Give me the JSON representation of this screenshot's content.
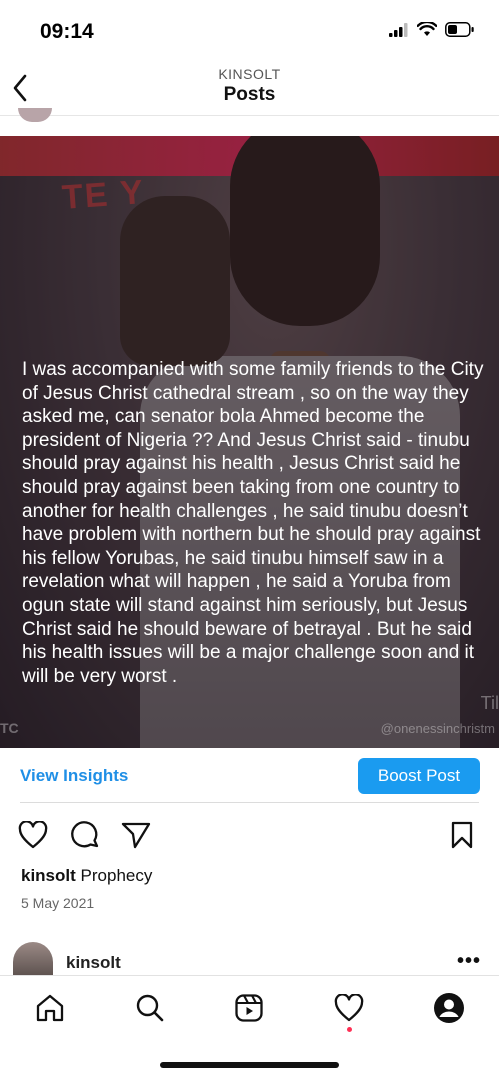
{
  "status_bar": {
    "time": "09:14"
  },
  "header": {
    "account": "KINSOLT",
    "title": "Posts"
  },
  "post": {
    "body_text": "I was accompanied with some family friends to the City of Jesus Christ cathedral stream ,  so on the way they asked me, can senator bola Ahmed become the president of Nigeria ?? And Jesus Christ said - tinubu should pray against his health ,  Jesus Christ said he should pray against been taking from one country to another for health challenges , he said tinubu doesn’t have problem with northern but he should pray against his fellow Yorubas, he said tinubu himself saw in a revelation what will happen ,  he said a Yoruba from ogun state will stand against him seriously,  but Jesus Christ said he should beware of betrayal .  But he said his health issues will be a major challenge soon and it will be very worst .",
    "banner_text": "TE Y",
    "watermark": "@onenessinchristm",
    "watermark_left": "TC",
    "watermark_right": "Til"
  },
  "insights": {
    "view_label": "View Insights",
    "boost_label": "Boost Post"
  },
  "caption": {
    "username": "kinsolt",
    "text": "Prophecy",
    "date": "5 May 2021"
  },
  "next_post": {
    "username": "kinsolt",
    "more": "•••"
  },
  "icons": {
    "back": "chevron-left-icon",
    "like": "heart-icon",
    "comment": "comment-icon",
    "share": "send-icon",
    "save": "bookmark-icon",
    "home": "home-icon",
    "search": "search-icon",
    "reels": "reels-icon",
    "activity": "heart-icon",
    "profile": "profile-icon"
  },
  "colors": {
    "accent": "#1a9bf0",
    "link": "#1f8fe6",
    "notification": "#ff2f54"
  }
}
